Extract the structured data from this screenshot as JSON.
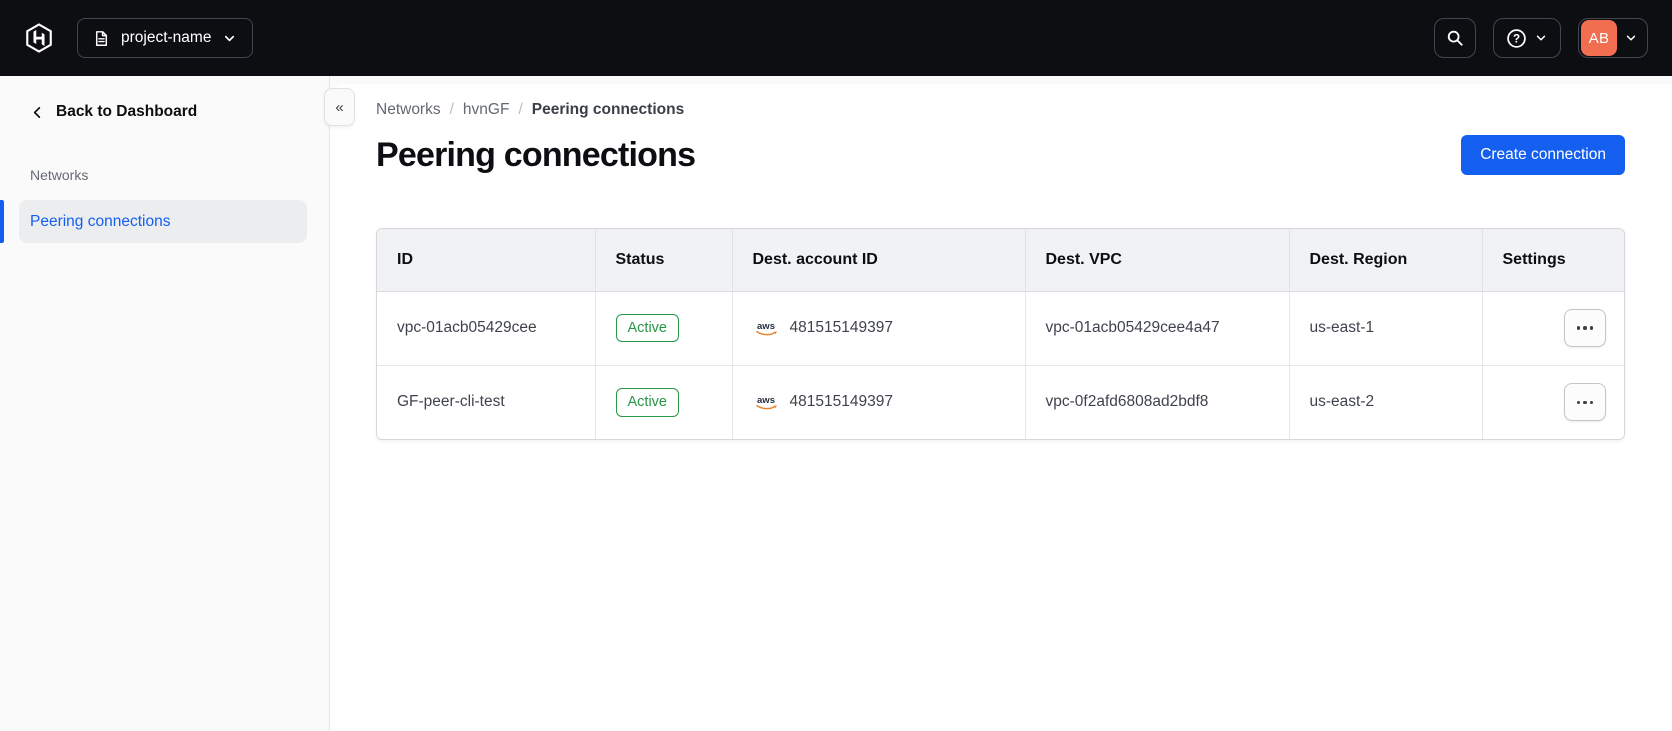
{
  "top_nav": {
    "project_switcher_label": "project-name",
    "avatar_initials": "AB"
  },
  "sidebar": {
    "back_link_label": "Back to Dashboard",
    "section_label": "Networks",
    "items": [
      {
        "label": "Peering connections",
        "active": true
      }
    ],
    "collapse_glyph": "«"
  },
  "breadcrumb": {
    "items": [
      "Networks",
      "hvnGF",
      "Peering connections"
    ],
    "separator": "/"
  },
  "page": {
    "title": "Peering connections",
    "primary_action_label": "Create connection"
  },
  "table": {
    "columns": [
      "ID",
      "Status",
      "Dest. account ID",
      "Dest. VPC",
      "Dest. Region",
      "Settings"
    ],
    "rows": [
      {
        "id": "vpc-01acb05429cee",
        "status": "Active",
        "provider": "aws",
        "account_id": "481515149397",
        "vpc": "vpc-01acb05429cee4a47",
        "region": "us-east-1"
      },
      {
        "id": "GF-peer-cli-test",
        "status": "Active",
        "provider": "aws",
        "account_id": "481515149397",
        "vpc": "vpc-0f2afd6808ad2bdf8",
        "region": "us-east-2"
      }
    ]
  },
  "colors": {
    "accent_blue": "#145ff0",
    "success_green": "#289646",
    "avatar_coral": "#f26e51",
    "nav_background": "#0d0e12",
    "sidebar_background": "#fafafa"
  }
}
